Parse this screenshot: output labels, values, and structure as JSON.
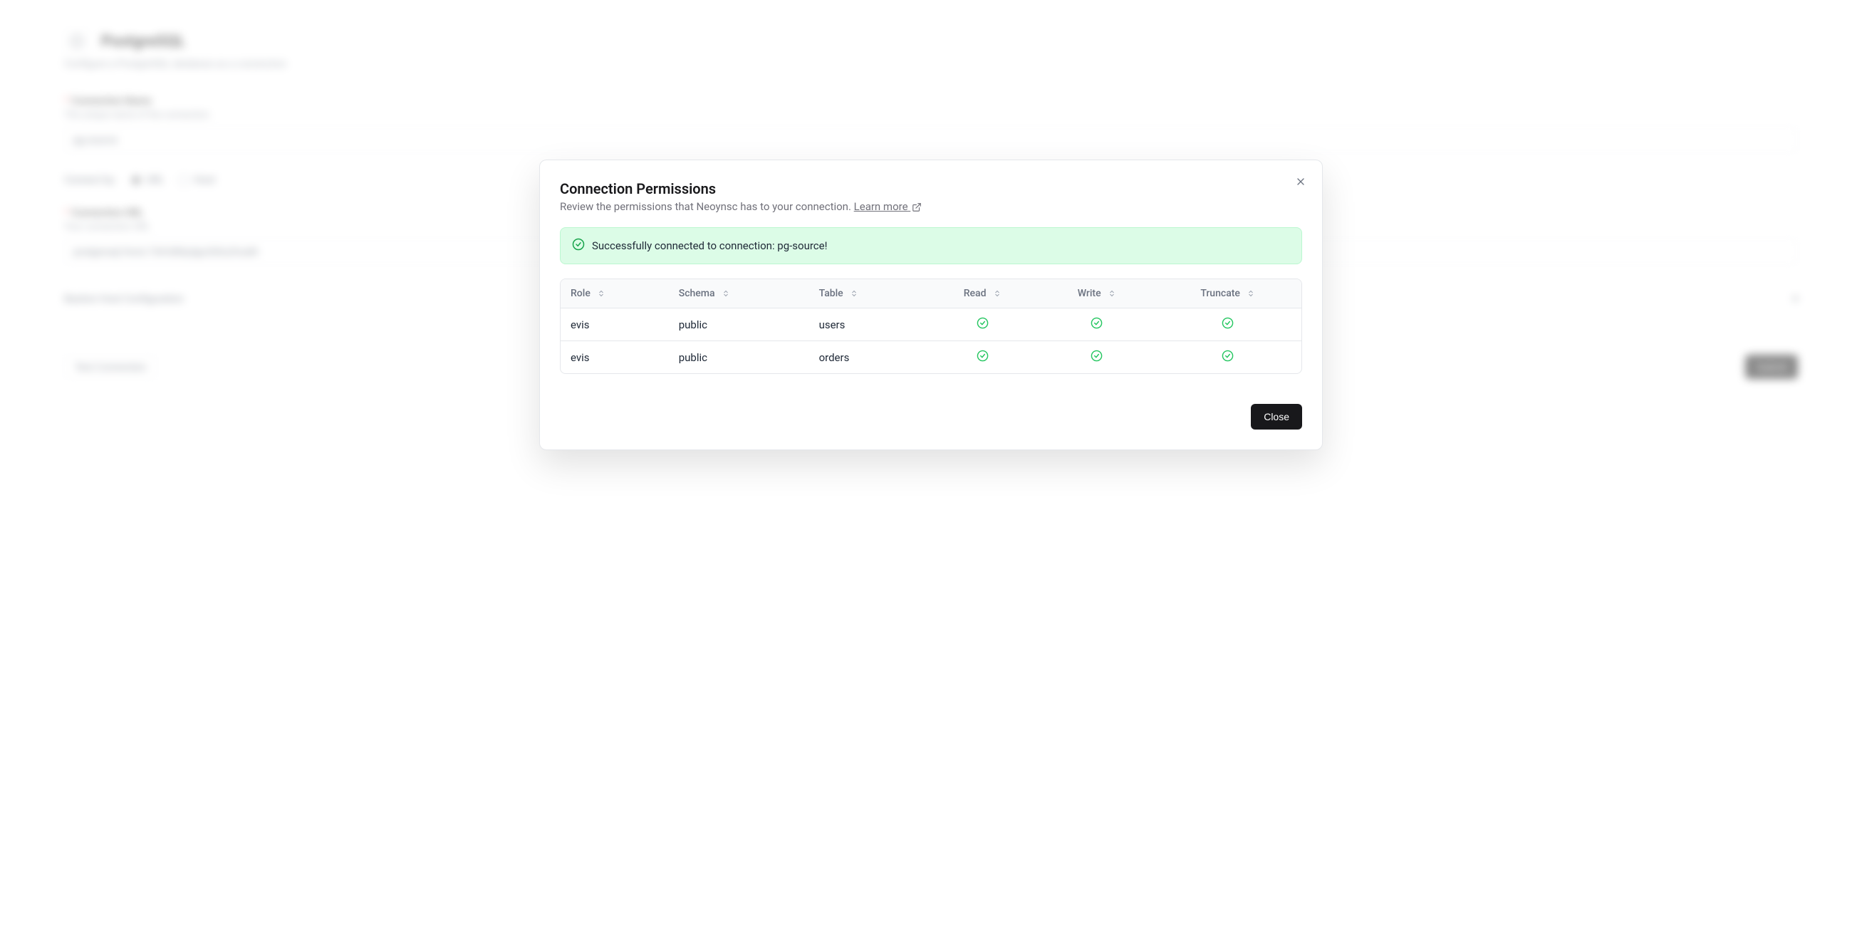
{
  "page": {
    "title": "PostgreSQL",
    "subtitle": "Configure a PostgreSQL database as a connection",
    "connection_name_label": "Connection Name",
    "connection_name_helper": "The unique name of the connection",
    "connection_name_value": "pg-source",
    "connect_by_label": "Connect by:",
    "connect_by_url": "URL",
    "connect_by_host": "Host",
    "connection_url_label": "Connection URL",
    "connection_url_helper": "Your connection URL",
    "connection_url_value": "postgresql://evis:73rh389ydgo283u2huidh",
    "bastion_label": "Bastion Host Configuration",
    "test_connection": "Test Connection",
    "submit": "Submit"
  },
  "modal": {
    "title": "Connection Permissions",
    "subtitle_text": "Review the permissions that Neoynsc has to your connection.",
    "learn_more": "Learn more",
    "alert_message": "Successfully connected to connection: pg-source!",
    "close_label": "Close",
    "columns": {
      "role": "Role",
      "schema": "Schema",
      "table": "Table",
      "read": "Read",
      "write": "Write",
      "truncate": "Truncate"
    },
    "rows": [
      {
        "role": "evis",
        "schema": "public",
        "table": "users",
        "read": true,
        "write": true,
        "truncate": true
      },
      {
        "role": "evis",
        "schema": "public",
        "table": "orders",
        "read": true,
        "write": true,
        "truncate": true
      }
    ]
  }
}
